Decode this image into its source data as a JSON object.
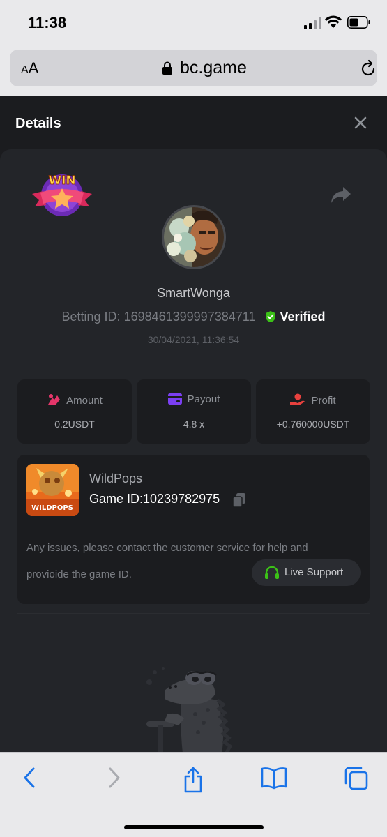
{
  "status": {
    "time": "11:38"
  },
  "browser": {
    "aa_small": "A",
    "aa_large": "A",
    "url": "bc.game"
  },
  "modal": {
    "title": "Details"
  },
  "bet": {
    "badge_text": "WIN",
    "username": "SmartWonga",
    "betting_id_label": "Betting ID:",
    "betting_id": "1698461399997384711",
    "verified_label": "Verified",
    "timestamp": "30/04/2021, 11:36:54"
  },
  "stats": {
    "amount_label": "Amount",
    "amount_value": "0.2USDT",
    "payout_label": "Payout",
    "payout_value": "4.8 x",
    "profit_label": "Profit",
    "profit_value": "+0.760000USDT"
  },
  "game": {
    "thumb_text": "WILDPOPS",
    "name": "WildPops",
    "id_label": "Game ID:",
    "id": "10239782975",
    "help_line_1": "Any issues, please contact the customer service for help and",
    "help_line_2": "provioide the game ID.",
    "live_support_label": "Live Support"
  },
  "colors": {
    "accent_green": "#3bc117",
    "amount_icon": "#e4366a",
    "payout_icon": "#7b3ff2",
    "profit_icon": "#e8413e",
    "ios_blue": "#1a73e8"
  },
  "icons": [
    "lock-icon",
    "reload-icon",
    "close-icon",
    "share-icon",
    "verified-icon",
    "copy-icon",
    "headset-icon",
    "back-icon",
    "forward-icon",
    "share-sheet-icon",
    "bookmarks-icon",
    "tabs-icon"
  ]
}
